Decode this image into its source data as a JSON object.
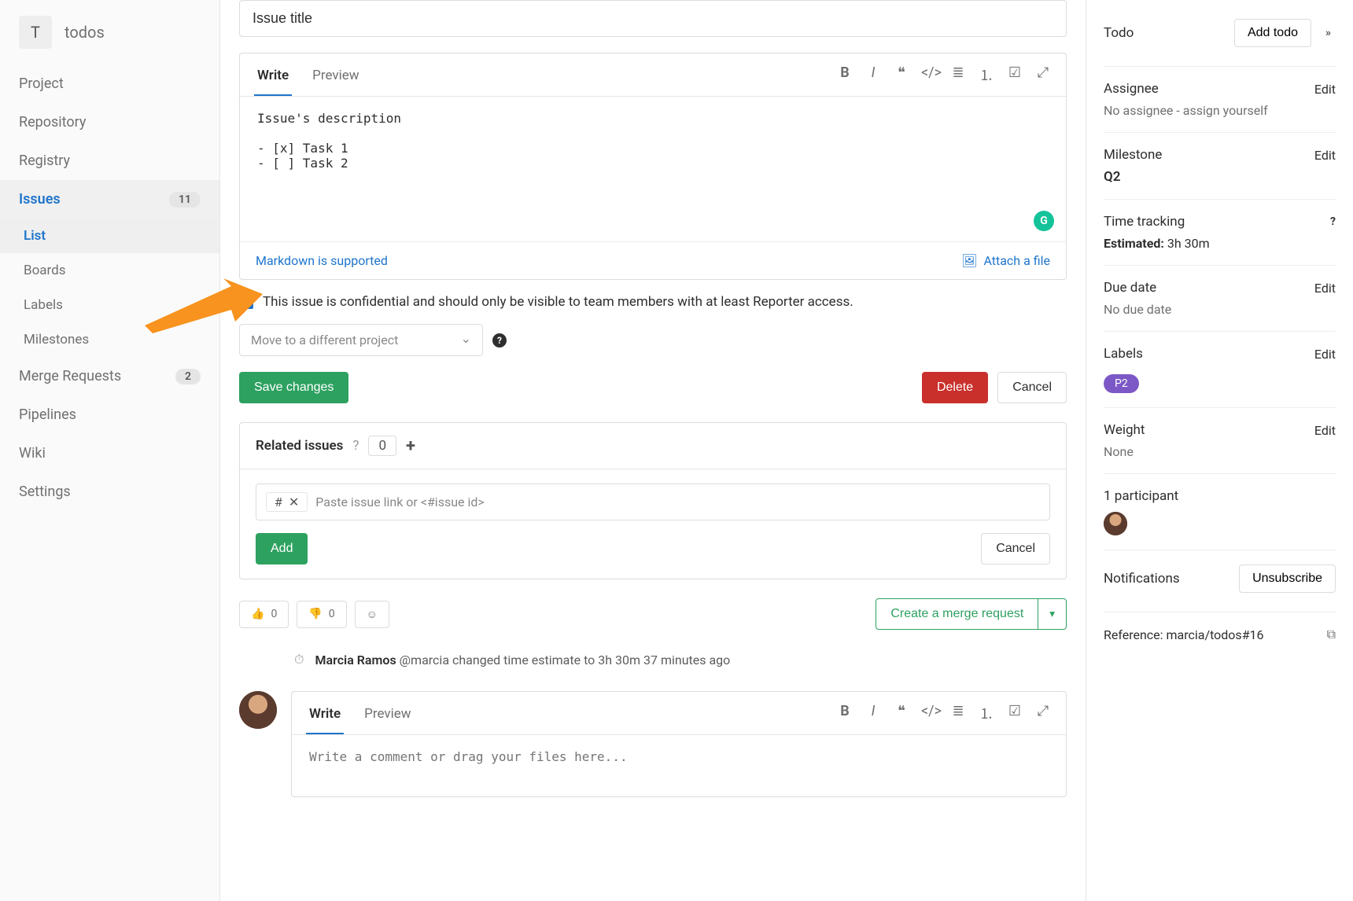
{
  "project": {
    "initial": "T",
    "name": "todos"
  },
  "sidebar": {
    "items": [
      {
        "label": "Project"
      },
      {
        "label": "Repository"
      },
      {
        "label": "Registry"
      },
      {
        "label": "Issues",
        "badge": "11"
      },
      {
        "label": "Merge Requests",
        "badge": "2"
      },
      {
        "label": "Pipelines"
      },
      {
        "label": "Wiki"
      },
      {
        "label": "Settings"
      }
    ],
    "issues_sub": [
      {
        "label": "List"
      },
      {
        "label": "Boards"
      },
      {
        "label": "Labels"
      },
      {
        "label": "Milestones"
      }
    ]
  },
  "issue": {
    "title": "Issue title",
    "description": "Issue's description\n\n- [x] Task 1\n- [ ] Task 2",
    "write_tab": "Write",
    "preview_tab": "Preview",
    "markdown_link": "Markdown is supported",
    "attach_link": "Attach a file",
    "confidential_label": "This issue is confidential and should only be visible to team members with at least Reporter access.",
    "move_placeholder": "Move to a different project",
    "save_btn": "Save changes",
    "delete_btn": "Delete",
    "cancel_btn": "Cancel"
  },
  "related": {
    "title": "Related issues",
    "count": "0",
    "chip": "#",
    "placeholder": "Paste issue link or <#issue id>",
    "add_btn": "Add",
    "cancel_btn": "Cancel"
  },
  "reactions": {
    "thumbs_up": "0",
    "thumbs_down": "0",
    "mr_btn": "Create a merge request"
  },
  "activity": {
    "user": "Marcia Ramos",
    "handle": "@marcia",
    "text": "changed time estimate to 3h 30m",
    "time": "37 minutes ago"
  },
  "comment": {
    "write_tab": "Write",
    "preview_tab": "Preview",
    "placeholder": "Write a comment or drag your files here..."
  },
  "right": {
    "todo_title": "Todo",
    "add_todo": "Add todo",
    "assignee_title": "Assignee",
    "assignee_none": "No assignee -",
    "assign_yourself": "assign yourself",
    "milestone_title": "Milestone",
    "milestone_value": "Q2",
    "time_title": "Time tracking",
    "time_estimated_label": "Estimated:",
    "time_estimated_value": "3h 30m",
    "due_title": "Due date",
    "due_value": "No due date",
    "labels_title": "Labels",
    "label_value": "P2",
    "weight_title": "Weight",
    "weight_value": "None",
    "participants": "1 participant",
    "notifications_title": "Notifications",
    "unsubscribe": "Unsubscribe",
    "reference_label": "Reference:",
    "reference_value": "marcia/todos#16",
    "edit": "Edit"
  }
}
